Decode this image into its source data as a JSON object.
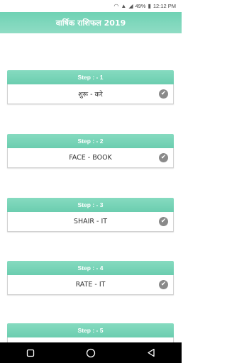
{
  "status_bar": {
    "battery": "49%",
    "time": "12:12 PM"
  },
  "app_bar": {
    "title": "वार्षिक राशिफल 2019"
  },
  "steps": [
    {
      "header": "Step : - 1",
      "label": "शुरू - करे"
    },
    {
      "header": "Step : - 2",
      "label": "FACE - BOOK"
    },
    {
      "header": "Step : - 3",
      "label": "SHAIR - IT"
    },
    {
      "header": "Step : - 4",
      "label": "RATE - IT"
    },
    {
      "header": "Step : - 5",
      "label": ""
    }
  ],
  "icons": {
    "check": "check-circle-icon",
    "nav": [
      "square-icon",
      "circle-icon",
      "back-triangle-icon"
    ]
  },
  "colors": {
    "accent": "#75d3b6",
    "check": "#8a8a8a",
    "nav_bar": "#000000"
  }
}
